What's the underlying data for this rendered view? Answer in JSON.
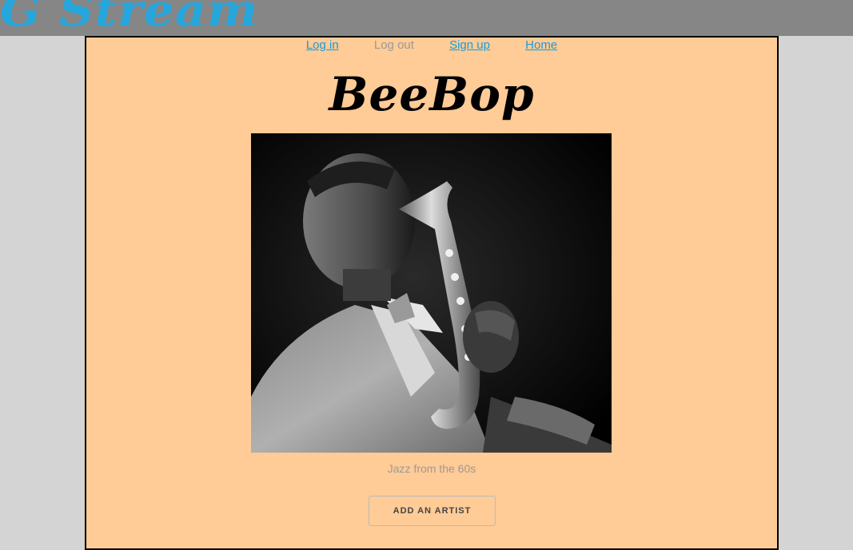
{
  "brand": {
    "name": "G Stream",
    "color": "#27a6dc"
  },
  "nav": {
    "items": [
      {
        "label": "Log in",
        "enabled": true
      },
      {
        "label": "Log out",
        "enabled": false
      },
      {
        "label": "Sign up",
        "enabled": true
      },
      {
        "label": "Home",
        "enabled": true
      }
    ]
  },
  "page": {
    "title": "BeeBop",
    "image": {
      "icon": "saxophone-player-photo"
    },
    "caption": "Jazz from the 60s",
    "action_label": "ADD AN ARTIST"
  },
  "colors": {
    "panel_bg": "#ffcb96",
    "topbar_bg": "#868686",
    "page_bg": "#d4d4d4",
    "link": "#1a9bd7",
    "muted": "#9a9a9a"
  }
}
